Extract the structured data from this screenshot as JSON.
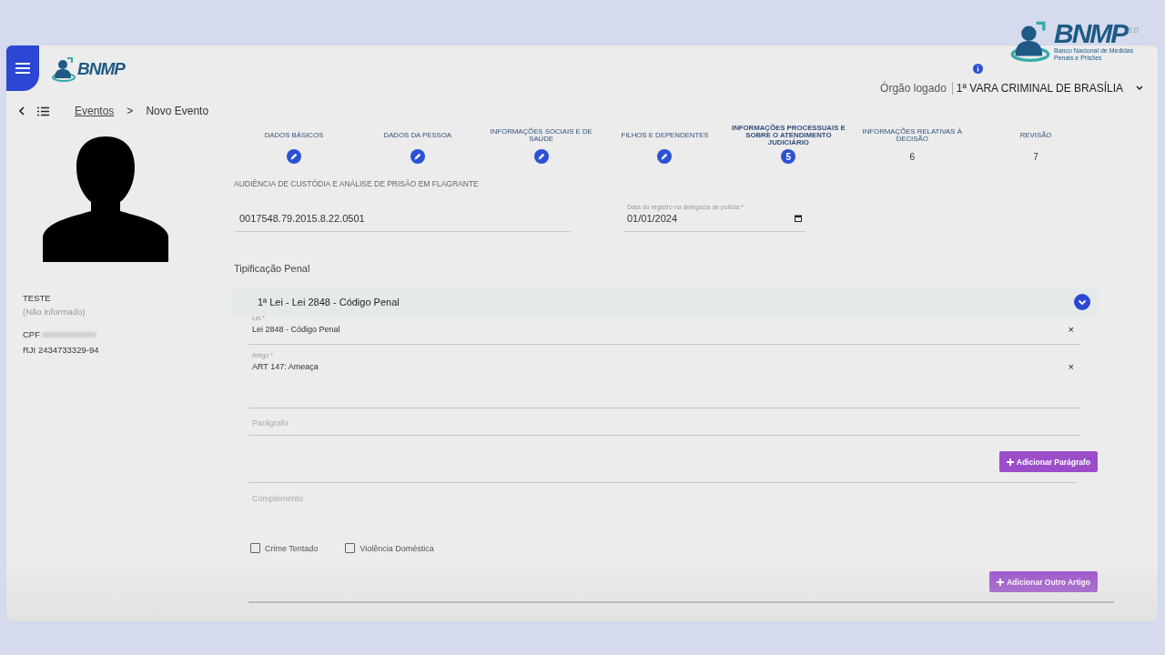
{
  "corner_logo": {
    "title": "BNMP",
    "version": "3.0",
    "subtitle": "Banco Nacional de Medidas Penais e Prisões"
  },
  "header": {
    "logo": {
      "title": "BNMP"
    },
    "organ": {
      "label": "Órgão logado",
      "value": "1ª VARA CRIMINAL DE BRASÍLIA"
    }
  },
  "breadcrumb": {
    "link": "Eventos",
    "separator": ">",
    "current": "Novo Evento"
  },
  "person": {
    "name": "TESTE",
    "note": "(Não informado)",
    "cpf_label": "CPF",
    "rji": "RJI 2434733329-94"
  },
  "steps": [
    {
      "label": "DADOS BÁSICOS",
      "kind": "done",
      "selected": false
    },
    {
      "label": "DADOS DA PESSOA",
      "kind": "done",
      "selected": false
    },
    {
      "label": "INFORMAÇÕES SOCIAIS E DE SAÚDE",
      "kind": "done",
      "selected": false
    },
    {
      "label": "FILHOS E DEPENDENTES",
      "kind": "done",
      "selected": false
    },
    {
      "label": "INFORMAÇÕES PROCESSUAIS E SOBRE O ATENDIMENTO JUDICIÁRIO",
      "number": "5",
      "kind": "current",
      "selected": true
    },
    {
      "label": "INFORMAÇÕES RELATIVAS À DECISÃO",
      "number": "6",
      "kind": "pending",
      "selected": false
    },
    {
      "label": "REVISÃO",
      "number": "7",
      "kind": "pending",
      "selected": false
    }
  ],
  "section_title": "AUDIÊNCIA DE CUSTÓDIA E ANÁLISE DE PRISÃO EM FLAGRANTE",
  "process_field": {
    "value": "0017548.79.2015.8.22.0501"
  },
  "date_field": {
    "label": "Data do registro na delegacia de polícia *",
    "value": "01/01/2024"
  },
  "tipificacao": {
    "title": "Tipificação Penal",
    "panel_title": "1ª Lei - Lei 2848 - Código Penal",
    "expanded": true,
    "lei": {
      "label": "Lei *",
      "value": "Lei 2848 - Código Penal",
      "clear": "×"
    },
    "artigo": {
      "label": "Artigo *",
      "value": "ART 147: Ameaça",
      "clear": "×"
    },
    "paragrafo": {
      "placeholder": "Parágrafo"
    },
    "add_paragraph": "Adicionar Parágrafo",
    "complemento": {
      "placeholder": "Complemento"
    },
    "checks": [
      {
        "label": "Crime Tentado",
        "checked": false
      },
      {
        "label": "Violência Doméstica",
        "checked": false
      }
    ],
    "add_article": "Adicionar Outro Artigo"
  }
}
